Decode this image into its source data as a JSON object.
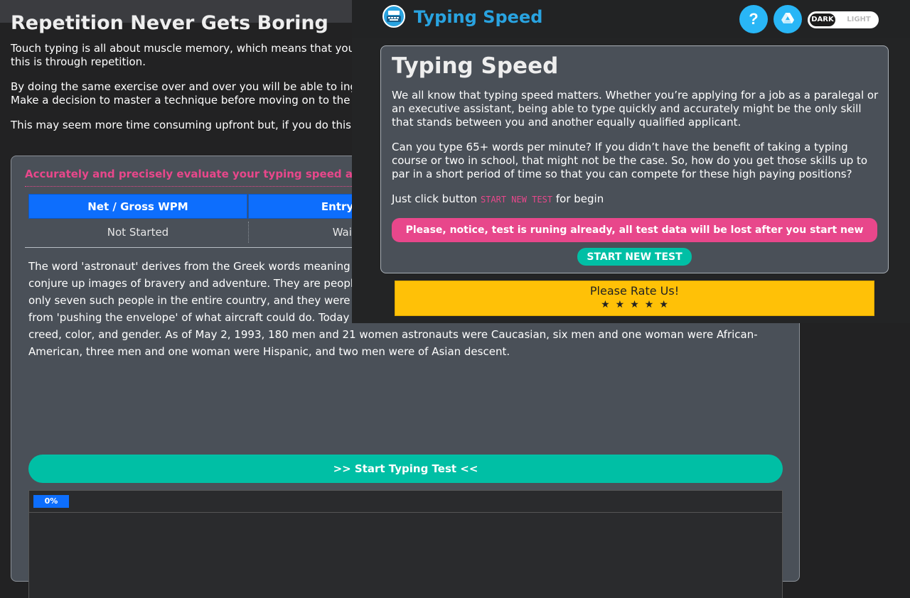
{
  "background": {
    "heading": "Repetition Never Gets Boring",
    "paragraphs": [
      "Touch typing is all about muscle memory, which means that your muscles need to memorise the movements. The best and quickest way to do this is through repetition.",
      "By doing the same exercise over and over you will be able to ingrain the movements into your muscle memory. Set a high standard for yourself.  Make a decision to master a technique before moving on to the next.",
      "This may seem more time consuming upfront but, if you do this the first time, you won't need to come back to previous lessons."
    ],
    "test_panel": {
      "subtitle": "Accurately and precisely evaluate your typing speed and accuracy",
      "columns": [
        "Net / Gross WPM",
        "Entry Errors"
      ],
      "values": [
        "Not Started",
        "Waiting..."
      ],
      "passage": "The word 'astronaut' derives from the Greek words meaning 'star sailor'. Astronauts -- Neil Armstrong and Buzz Aldrin to name a few -- conjure up images of bravery and adventure. They are people who fly in outer space. When the space program began in 1959, there were only seven such people in the entire country, and they were all white males. All of them were test pilots, used to the dangers that came from 'pushing the envelope' of what aircraft could do. Today the Americans who make up the shuttle crews are comprised of every race, creed, color, and gender. As of May 2, 1993, 180 men and 21 women astronauts were Caucasian, six men and one woman were African-American, three men and one woman were Hispanic, and two men were of Asian descent.",
      "start_button": ">> Start Typing Test <<",
      "progress_label": "0%",
      "progress_fraction": 0
    }
  },
  "popup": {
    "app_title": "Typing Speed",
    "help_label": "?",
    "theme": {
      "dark": "DARK",
      "light": "LIGHT",
      "selected": "DARK"
    },
    "card_title": "Typing Speed",
    "paragraph1": "We all know that typing speed matters. Whether you’re applying for a job as a paralegal or an executive assistant, being able to type quickly and accurately might be the only skill that stands between you and another equally qualified applicant.",
    "paragraph2": "Can you type 65+ words per minute? If you didn’t have the benefit of taking a typing course or two in school, that might not be the case. So, how do you get those skills up to par in a short period of time so that you can compete for these high paying positions?",
    "instruction_prefix": "Just click button",
    "instruction_keyword": "START NEW TEST",
    "instruction_suffix": "for begin",
    "notice": "Please, notice, test is runing already, all test data will be lost after you start new one.",
    "new_test_button": "START NEW TEST",
    "rate_label": "Please Rate Us!",
    "stars": "★★★★★",
    "colors": {
      "accent_blue": "#29a3e0",
      "pink": "#e8478b",
      "teal": "#00bfa5",
      "yellow": "#ffc107",
      "table_blue": "#0d6efd"
    }
  }
}
